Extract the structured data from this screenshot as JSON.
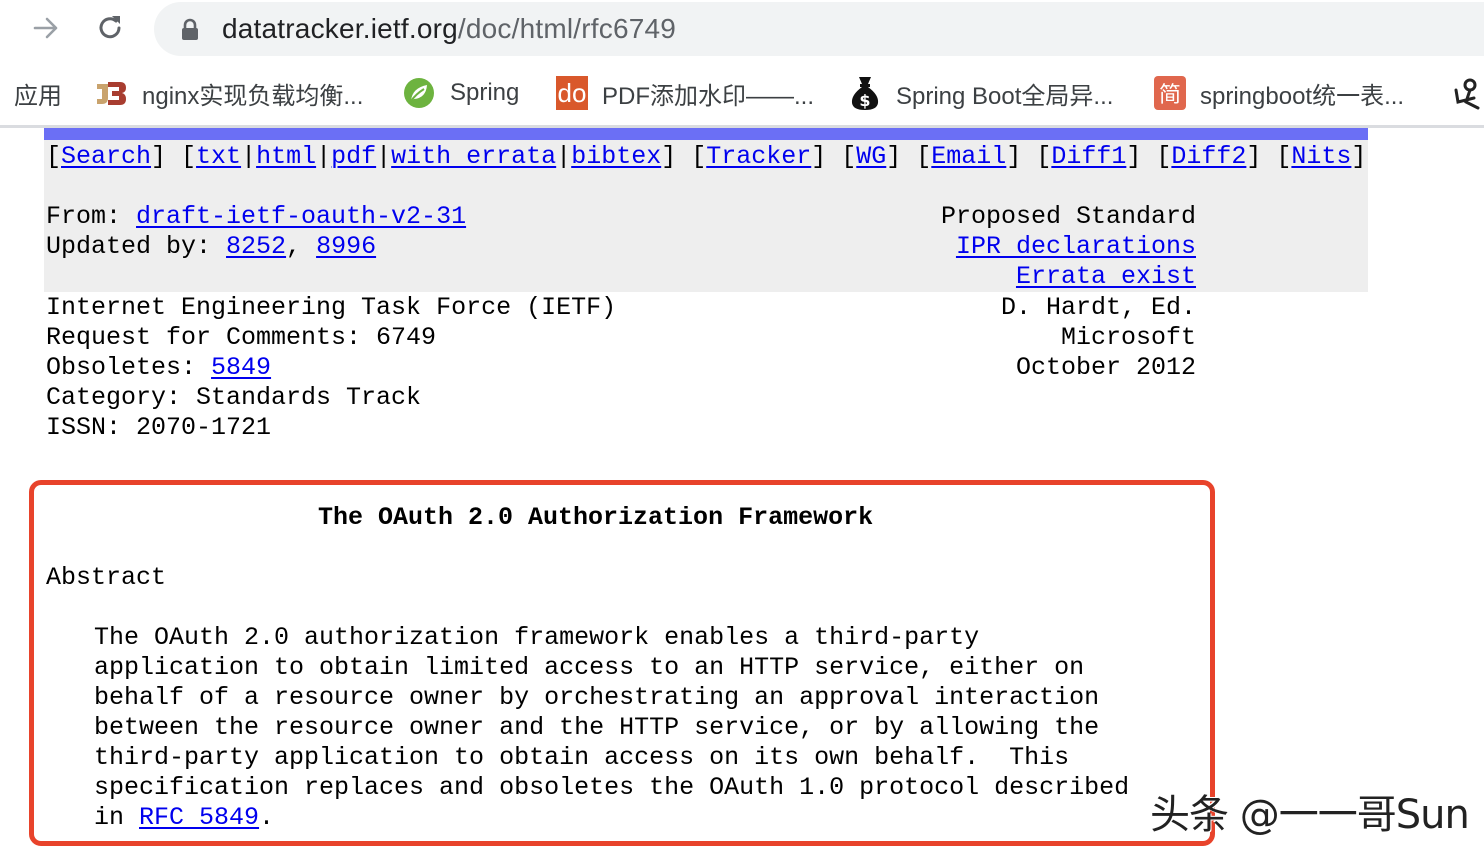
{
  "browser": {
    "url_host": "datatracker.ietf.org",
    "url_path": "/doc/html/rfc6749",
    "bookmarks": [
      {
        "label": "应用",
        "icon": "apps-icon"
      },
      {
        "label": "nginx实现负载均衡...",
        "icon": "jb-favicon"
      },
      {
        "label": "Spring",
        "icon": "spring-leaf-icon"
      },
      {
        "label": "PDF添加水印——...",
        "icon": "do-favicon"
      },
      {
        "label": "Spring Boot全局异...",
        "icon": "money-bag-icon"
      },
      {
        "label": "springboot统一表...",
        "icon": "jian-favicon"
      },
      {
        "label": "",
        "icon": "figure-favicon"
      }
    ],
    "icons": {
      "do": "do",
      "jian": "简",
      "dollar": "$"
    }
  },
  "nav": {
    "links": [
      {
        "label": "Search"
      },
      {
        "label": "txt"
      },
      {
        "label": "html"
      },
      {
        "label": "pdf"
      },
      {
        "label": "with errata"
      },
      {
        "label": "bibtex"
      },
      {
        "label": "Tracker"
      },
      {
        "label": "WG"
      },
      {
        "label": "Email"
      },
      {
        "label": "Diff1"
      },
      {
        "label": "Diff2"
      },
      {
        "label": "Nits"
      }
    ]
  },
  "meta": {
    "from_label": "From: ",
    "from_link": "draft-ietf-oauth-v2-31",
    "updated_label": "Updated by: ",
    "updated_links": [
      "8252",
      "8996"
    ],
    "status": "Proposed Standard",
    "ipr_link": "IPR declarations",
    "errata_link": "Errata exist"
  },
  "header": {
    "org": "Internet Engineering Task Force (IETF)",
    "rfc": "Request for Comments: 6749",
    "obsoletes_label": "Obsoletes: ",
    "obsoletes_link": "5849",
    "category": "Category: Standards Track",
    "issn": "ISSN: 2070-1721",
    "author": "D. Hardt, Ed.",
    "company": "Microsoft",
    "date": "October 2012"
  },
  "document": {
    "title": "The OAuth 2.0 Authorization Framework",
    "abstract_heading": "Abstract",
    "abstract_lines": [
      "The OAuth 2.0 authorization framework enables a third-party",
      "application to obtain limited access to an HTTP service, either on",
      "behalf of a resource owner by orchestrating an approval interaction",
      "between the resource owner and the HTTP service, or by allowing the",
      "third-party application to obtain access on its own behalf.  This",
      "specification replaces and obsoletes the OAuth 1.0 protocol described"
    ],
    "abstract_last_prefix": "in ",
    "abstract_last_link": "RFC 5849",
    "abstract_last_suffix": "."
  },
  "overlay": {
    "highlight_color": "#e8432b",
    "watermark": "头条 @一一哥Sun"
  },
  "colors": {
    "link": "#0000ee",
    "meta_bar": "#6b6ff5",
    "meta_bg": "#eeeeee"
  }
}
